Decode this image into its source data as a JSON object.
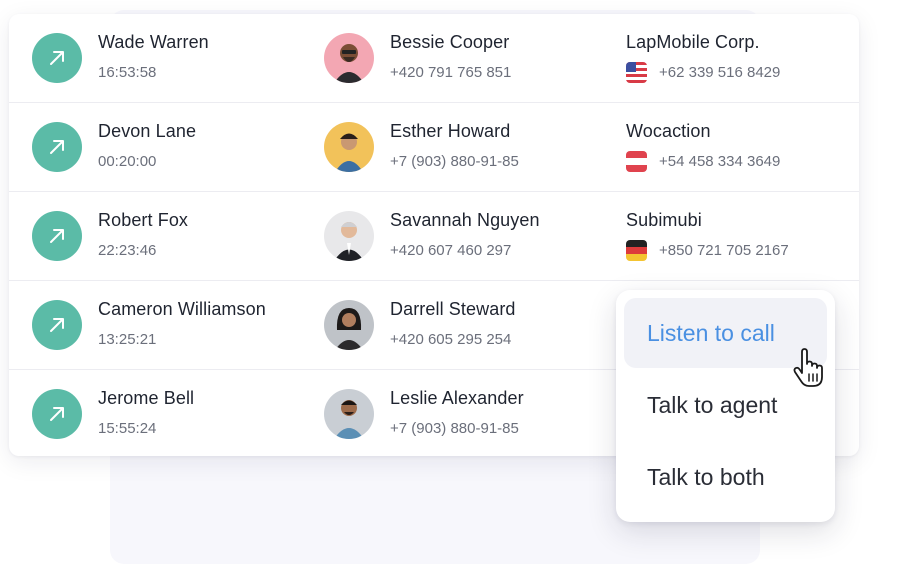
{
  "calls": [
    {
      "agent": "Wade Warren",
      "duration": "16:53:58",
      "caller": "Bessie Cooper",
      "caller_phone": "+420 791 765 851",
      "company": "LapMobile Corp.",
      "company_phone": "+62 339 516 8429",
      "flag": "us-flag-icon",
      "avatar_bg": "#f3a7b3"
    },
    {
      "agent": "Devon Lane",
      "duration": "00:20:00",
      "caller": "Esther Howard",
      "caller_phone": "+7 (903) 880-91-85",
      "company": "Wocaction",
      "company_phone": "+54 458 334 3649",
      "flag": "austria-flag-icon",
      "avatar_bg": "#f2c25a"
    },
    {
      "agent": "Robert Fox",
      "duration": "22:23:46",
      "caller": "Savannah Nguyen",
      "caller_phone": "+420 607 460 297",
      "company": "Subimubi",
      "company_phone": "+850 721 705 2167",
      "flag": "germany-flag-icon",
      "avatar_bg": "#e8e8ea"
    },
    {
      "agent": "Cameron Williamson",
      "duration": "13:25:21",
      "caller": "Darrell Steward",
      "caller_phone": "+420 605 295 254",
      "avatar_bg": "#bfc3c8"
    },
    {
      "agent": "Jerome Bell",
      "duration": "15:55:24",
      "caller": "Leslie Alexander",
      "caller_phone": "+7 (903) 880-91-85",
      "avatar_bg": "#c9ced4"
    }
  ],
  "menu": {
    "items": [
      "Listen to call",
      "Talk to agent",
      "Talk to both"
    ],
    "active_index": 0
  },
  "colors": {
    "call_icon": "#5bbba7",
    "accent": "#4a90e2"
  }
}
